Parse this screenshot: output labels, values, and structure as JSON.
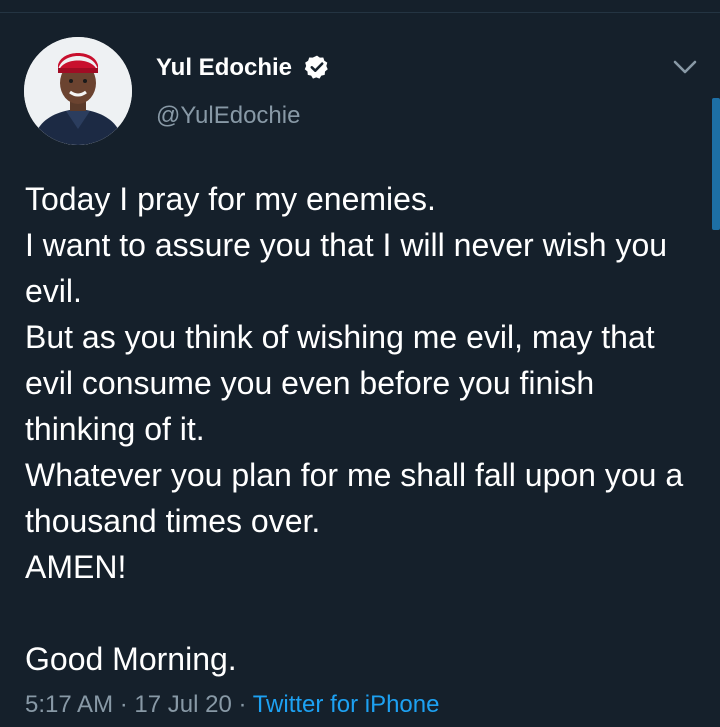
{
  "tweet": {
    "author": {
      "display_name": "Yul Edochie",
      "handle": "@YulEdochie",
      "verified_icon": "verified-badge-icon",
      "avatar": "profile-photo"
    },
    "text": "Today I pray for my enemies.\nI want to assure you that I will never wish you evil.\nBut as you think of wishing me evil, may that evil consume you even before you finish thinking of it.\nWhatever you plan for me shall fall upon you a thousand times over.\nAMEN!\n\nGood Morning.",
    "time": "5:17 AM",
    "separator": "·",
    "date": "17 Jul 20",
    "source": "Twitter for iPhone",
    "menu_icon": "chevron-down-icon"
  },
  "colors": {
    "background": "#15202b",
    "text": "#ffffff",
    "muted": "#8899a6",
    "link": "#1da1f2"
  }
}
